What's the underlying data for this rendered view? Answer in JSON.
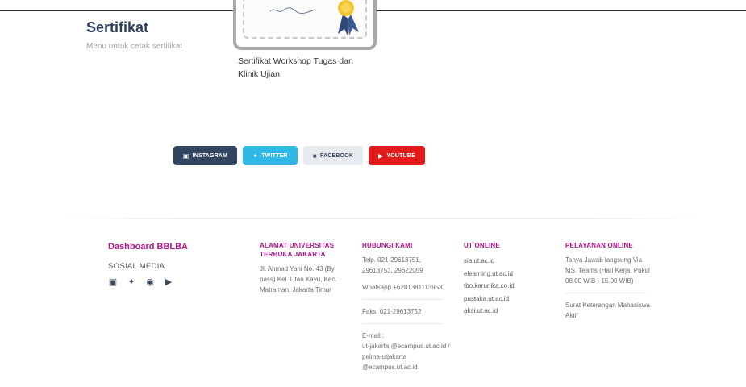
{
  "section": {
    "title": "Sertifikat",
    "subtitle": "Menu untuk cetak sertifikat"
  },
  "certificate": {
    "caption": "Sertifikat Workshop Tugas dan Klinik Ujian"
  },
  "social_buttons": {
    "instagram": "INSTAGRAM",
    "twitter": "TWITTER",
    "facebook": "FACEBOOK",
    "youtube": "YOUTUBE"
  },
  "footer": {
    "brand": "Dashboard BBLBA",
    "social_label": "SOSIAL MEDIA",
    "social_icons": [
      "instagram-icon",
      "twitter-icon",
      "facebook-icon",
      "youtube-icon"
    ],
    "address": {
      "heading": "ALAMAT UNIVERSITAS TERBUKA JAKARTA",
      "text": "Jl. Ahmad Yani No. 43 (By pass) Kel. Utan Kayu, Kec. Matraman, Jakarta Timur"
    },
    "contact": {
      "heading": "HUBUNGI KAMI",
      "phone": "Telp. 021-29613751, 29613753, 29622059",
      "whatsapp": "Whatsapp +6281381113953",
      "fax": "Faks. 021-29613752",
      "email_label": "E-mail :",
      "email": "ut-jakarta @ecampus.ut.ac.id / pelma-utjakarta @ecampus.ut.ac.id"
    },
    "ut_online": {
      "heading": "UT ONLINE",
      "links": [
        "sia.ut.ac.id",
        "elearning.ut.ac.id",
        "tbo.karunika.co.id",
        "pustaka.ut.ac.id",
        "aksi.ut.ac.id"
      ]
    },
    "pelayanan": {
      "heading": "PELAYANAN ONLINE",
      "teams": "Tanya Jawab langsung Via MS. Teams (Hari Kerja, Pukul 08.00 WIB - 15.00 WIB)",
      "surat": "Surat Keterangan Mahasiswa Aktif"
    }
  },
  "colors": {
    "heading_magenta": "#b0168a",
    "title_navy": "#2f3f5f",
    "instagram_bg": "#324560",
    "twitter_bg": "#2fb7e6",
    "facebook_bg": "#e7eaef",
    "youtube_bg": "#e21a1a"
  }
}
